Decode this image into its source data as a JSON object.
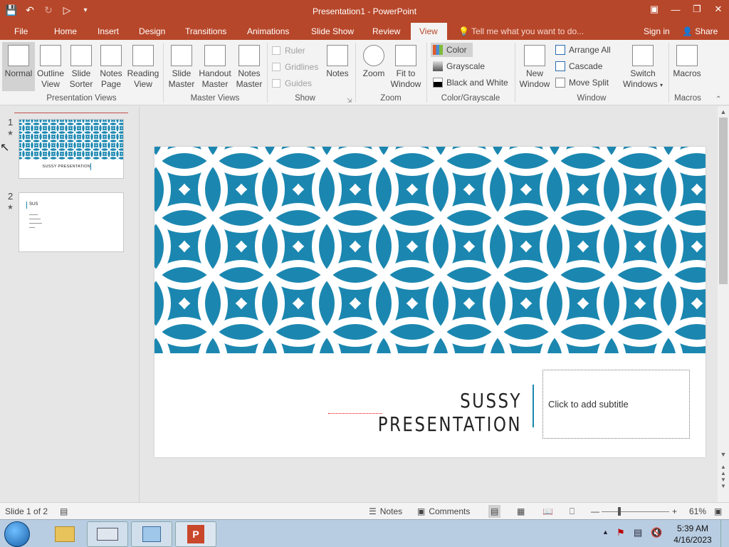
{
  "app": {
    "window_title": "Presentation1 - PowerPoint",
    "accent_color": "#b7472a"
  },
  "tabs": [
    {
      "label": "File"
    },
    {
      "label": "Home"
    },
    {
      "label": "Insert"
    },
    {
      "label": "Design"
    },
    {
      "label": "Transitions"
    },
    {
      "label": "Animations"
    },
    {
      "label": "Slide Show"
    },
    {
      "label": "Review"
    },
    {
      "label": "View"
    }
  ],
  "active_tab": "View",
  "tell_me": "Tell me what you want to do...",
  "sign_in": "Sign in",
  "share": "Share",
  "ribbon": {
    "presentation_views": {
      "label": "Presentation Views",
      "normal_l1": "Normal",
      "outline_l1": "Outline",
      "outline_l2": "View",
      "sorter_l1": "Slide",
      "sorter_l2": "Sorter",
      "notes_l1": "Notes",
      "notes_l2": "Page",
      "reading_l1": "Reading",
      "reading_l2": "View"
    },
    "master_views": {
      "label": "Master Views",
      "slide_l1": "Slide",
      "slide_l2": "Master",
      "handout_l1": "Handout",
      "handout_l2": "Master",
      "notes_l1": "Notes",
      "notes_l2": "Master"
    },
    "show": {
      "label": "Show",
      "ruler": "Ruler",
      "gridlines": "Gridlines",
      "guides": "Guides",
      "notes": "Notes"
    },
    "zoom": {
      "label": "Zoom",
      "zoom": "Zoom",
      "fit_l1": "Fit to",
      "fit_l2": "Window"
    },
    "color_grayscale": {
      "label": "Color/Grayscale",
      "color": "Color",
      "grayscale": "Grayscale",
      "bw": "Black and White"
    },
    "window": {
      "label": "Window",
      "new_l1": "New",
      "new_l2": "Window",
      "arrange_all": "Arrange All",
      "cascade": "Cascade",
      "move_split": "Move Split",
      "switch_l1": "Switch",
      "switch_l2": "Windows"
    },
    "macros": {
      "label": "Macros",
      "macros": "Macros"
    }
  },
  "thumbnails": [
    {
      "number": "1",
      "title": "SUSSY PRESENTATION"
    },
    {
      "number": "2",
      "title": "SUS"
    }
  ],
  "slide": {
    "title": "SUSSY PRESENTATION",
    "subtitle_placeholder": "Click to add subtitle",
    "band_color": "#1b87b0"
  },
  "status": {
    "slide_info": "Slide 1 of 2",
    "notes": "Notes",
    "comments": "Comments",
    "zoom": "61%"
  },
  "taskbar": {
    "time": "5:39 AM",
    "date": "4/16/2023"
  }
}
